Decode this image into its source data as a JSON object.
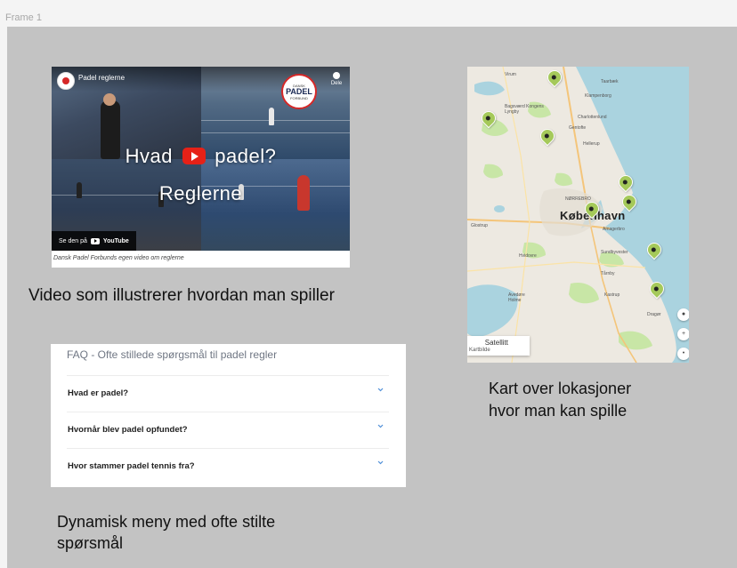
{
  "frame": {
    "label": "Frame 1"
  },
  "video": {
    "title": "Padel reglerne",
    "share_label": "Dele",
    "overlay_line1_left": "Hvad",
    "overlay_line1_right": "padel?",
    "overlay_line2": "Reglerne",
    "watch_on": "Se den på",
    "watch_on_brand": "YouTube",
    "logo": {
      "l1": "DANSK",
      "l2": "PADEL",
      "l3": "FORBUND"
    },
    "caption": "Dansk Padel Forbunds egen video om reglerne",
    "heading": "Video som illustrerer hvordan man spiller"
  },
  "map": {
    "city": "København",
    "labels": {
      "virum": "Virum",
      "taarbaek": "Taarbæk",
      "klampenborg": "Klampenborg",
      "lyngby": "Bagsværd Kongens Lyngby",
      "charlottenlund": "Charlottenlund",
      "gentofte": "Gentofte",
      "hellerup": "Hellerup",
      "norrebro": "NØRREBRO",
      "amager": "Amagerbro",
      "sundbyvester": "Sundbyvester",
      "taarnby": "Tårnby",
      "kastrup": "Kastrup",
      "dragor": "Dragør",
      "hvidovre": "Hvidovre",
      "avedore": "Avedøre Holme",
      "glostrup": "Glostrup"
    },
    "satellite_label": "Satellitt",
    "kartbilde_label": "Kartbilde",
    "heading_line1": "Kart over lokasjoner",
    "heading_line2": "hvor man kan spille"
  },
  "faq": {
    "title": "FAQ - Ofte stillede spørgsmål til padel regler",
    "items": [
      {
        "question": "Hvad er padel?"
      },
      {
        "question": "Hvornår blev padel opfundet?"
      },
      {
        "question": "Hvor stammer padel tennis fra?"
      }
    ],
    "heading_line1": "Dynamisk meny med ofte stilte",
    "heading_line2": "spørsmål"
  },
  "colors": {
    "frame_bg": "#c3c3c3",
    "pin": "#a5c95a",
    "youtube_red": "#e62117",
    "water": "#aad3df"
  }
}
